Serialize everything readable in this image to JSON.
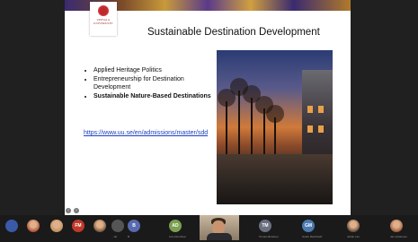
{
  "slide": {
    "logo_text": "UPPSALA UNIVERSITET",
    "title": "Sustainable Destination Development",
    "bullets": [
      {
        "text": "Applied Heritage Politics",
        "bold": false
      },
      {
        "text": "Entrepreneurship for Destination Development",
        "bold": false
      },
      {
        "text": "Sustainable Nature-Based Destinations",
        "bold": true
      }
    ],
    "link": "https://www.uu.se/en/admissions/master/sdd"
  },
  "participants": [
    {
      "initials": "",
      "name": "",
      "color": "#3a5aa8",
      "photo": false
    },
    {
      "initials": "",
      "name": "",
      "color": "#b0503a",
      "photo": true
    },
    {
      "initials": "",
      "name": "",
      "color": "#c09060",
      "photo": true
    },
    {
      "initials": "FM",
      "name": "",
      "color": "#c0392b",
      "photo": false
    },
    {
      "initials": "",
      "name": "",
      "color": "#7a5a40",
      "photo": true
    },
    {
      "initials": "",
      "name": "…ali",
      "color": "#555555",
      "photo": false
    },
    {
      "initials": "B",
      "name": "B",
      "color": "#5a6ab0",
      "photo": false
    },
    {
      "initials": "AD",
      "name": "Ann-Dorothea",
      "color": "#7aa050",
      "photo": false
    },
    {
      "initials": "",
      "name": "",
      "color": "",
      "photo": true,
      "video": true
    },
    {
      "initials": "TM",
      "name": "Tomas Meissner",
      "color": "#6a7080",
      "photo": false
    },
    {
      "initials": "GM",
      "name": "Guido Meinhardt",
      "color": "#4a7ab0",
      "photo": false
    },
    {
      "initials": "",
      "name": "Johan Lön",
      "color": "#6a5040",
      "photo": true
    },
    {
      "initials": "",
      "name": "Jan-Johannes",
      "color": "#a06040",
      "photo": true
    }
  ]
}
